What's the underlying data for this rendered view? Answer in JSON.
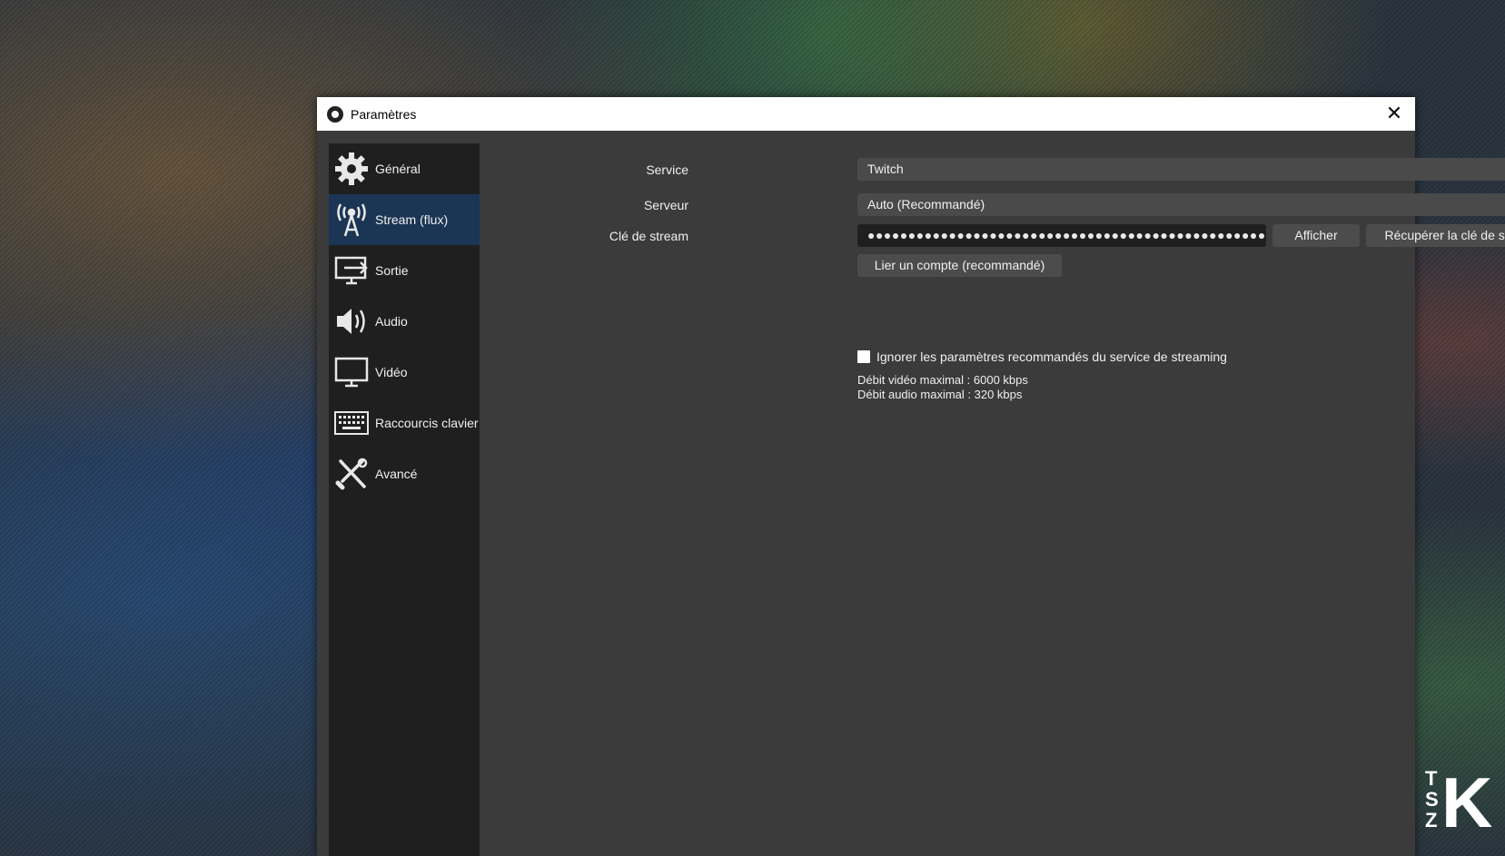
{
  "window": {
    "title": "Paramètres",
    "close_glyph": "✕"
  },
  "sidebar": {
    "items": [
      {
        "label": "Général",
        "icon": "gear-icon"
      },
      {
        "label": "Stream (flux)",
        "icon": "broadcast-antenna-icon",
        "active": true
      },
      {
        "label": "Sortie",
        "icon": "output-monitor-icon"
      },
      {
        "label": "Audio",
        "icon": "speaker-icon"
      },
      {
        "label": "Vidéo",
        "icon": "monitor-icon"
      },
      {
        "label": "Raccourcis clavier",
        "icon": "keyboard-icon"
      },
      {
        "label": "Avancé",
        "icon": "tools-icon"
      }
    ]
  },
  "stream": {
    "service_label": "Service",
    "service_value": "Twitch",
    "server_label": "Serveur",
    "server_value": "Auto (Recommandé)",
    "key_label": "Clé de stream",
    "key_value": "●●●●●●●●●●●●●●●●●●●●●●●●●●●●●●●●●●●●●●●●●●●●●●●●●●",
    "show_button": "Afficher",
    "get_key_button": "Récupérer la clé de stream",
    "connect_button": "Lier un compte (recommandé)",
    "ignore_checkbox_label": "Ignorer les paramètres recommandés du service de streaming",
    "ignore_checked": false,
    "max_video_bitrate": "Débit vidéo maximal : 6000 kbps",
    "max_audio_bitrate": "Débit audio maximal : 320 kbps"
  },
  "colors": {
    "window_bg": "#3b3b3b",
    "sidebar_bg": "#1f1f1f",
    "sidebar_active": "#1b3554",
    "input_bg": "#4a4a4a",
    "key_bg": "#1f1f1f"
  },
  "watermark": "TSZK"
}
